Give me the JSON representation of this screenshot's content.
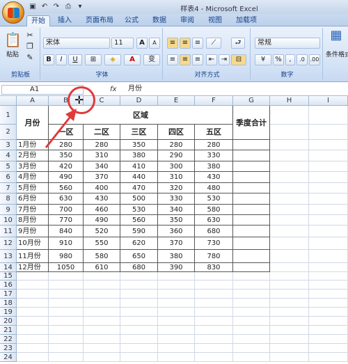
{
  "window": {
    "title": "样表4 - Microsoft Excel"
  },
  "tabs": [
    "开始",
    "插入",
    "页面布局",
    "公式",
    "数据",
    "审阅",
    "视图",
    "加载项"
  ],
  "ribbon": {
    "clipboard": {
      "paste": "粘贴",
      "label": "剪贴板"
    },
    "font": {
      "name": "宋体",
      "size": "11",
      "label": "字体",
      "grow": "A",
      "shrink": "A"
    },
    "alignment": {
      "label": "对齐方式"
    },
    "number": {
      "format": "常规",
      "label": "数字",
      "percent": "%",
      "comma": ","
    },
    "styles": {
      "cond": "条件格式"
    }
  },
  "formula_bar": {
    "name_box": "A1",
    "fx": "fx",
    "value": "月份"
  },
  "columns": [
    "A",
    "B",
    "C",
    "D",
    "E",
    "F",
    "G",
    "H",
    "I"
  ],
  "rows": [
    "1",
    "2",
    "3",
    "4",
    "5",
    "6",
    "7",
    "8",
    "9",
    "10",
    "11",
    "12",
    "13",
    "14",
    "15",
    "16",
    "17",
    "18",
    "19",
    "20",
    "21",
    "22",
    "23",
    "24"
  ],
  "table": {
    "month_header": "月份",
    "region_header": "区域",
    "quarter_header": "季度合计",
    "zones": [
      "一区",
      "二区",
      "三区",
      "四区",
      "五区"
    ],
    "data": [
      [
        "1月份",
        "280",
        "280",
        "350",
        "280",
        "280"
      ],
      [
        "2月份",
        "350",
        "310",
        "380",
        "290",
        "330"
      ],
      [
        "3月份",
        "420",
        "340",
        "410",
        "300",
        "380"
      ],
      [
        "4月份",
        "490",
        "370",
        "440",
        "310",
        "430"
      ],
      [
        "5月份",
        "560",
        "400",
        "470",
        "320",
        "480"
      ],
      [
        "6月份",
        "630",
        "430",
        "500",
        "330",
        "530"
      ],
      [
        "7月份",
        "700",
        "460",
        "530",
        "340",
        "580"
      ],
      [
        "8月份",
        "770",
        "490",
        "560",
        "350",
        "630"
      ],
      [
        "9月份",
        "840",
        "520",
        "590",
        "360",
        "680"
      ],
      [
        "10月份",
        "910",
        "550",
        "620",
        "370",
        "730"
      ],
      [
        "11月份",
        "980",
        "580",
        "650",
        "380",
        "780"
      ],
      [
        "12月份",
        "1050",
        "610",
        "680",
        "390",
        "830"
      ]
    ]
  }
}
